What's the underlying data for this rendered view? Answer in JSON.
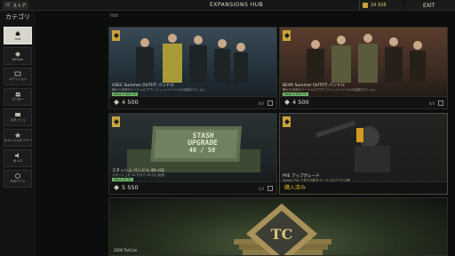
{
  "topbar": {
    "store_tab": "ストア",
    "hub_title": "EXPANSIONS HUB",
    "balance": "24 938",
    "exit_label": "EXIT"
  },
  "sidebar": {
    "heading": "カテゴリ",
    "items": [
      {
        "label": "Hot",
        "icon": "flame-icon",
        "active": true
      },
      {
        "label": "TarCoin",
        "icon": "coin-icon",
        "active": false
      },
      {
        "label": "エディション",
        "icon": "box-icon",
        "active": false
      },
      {
        "label": "アバター",
        "icon": "people-icon",
        "active": false
      },
      {
        "label": "スタッシュ",
        "icon": "crate-icon",
        "active": false
      },
      {
        "label": "スペシャルオファー",
        "icon": "star-icon",
        "active": false
      },
      {
        "label": "ボイス",
        "icon": "speaker-icon",
        "active": false
      },
      {
        "label": "PvEゾーン",
        "icon": "zone-icon",
        "active": false
      }
    ]
  },
  "filter_label": "Hot",
  "cards": [
    {
      "name": "USEC Summer OUTFIT バンドル",
      "desc": "極から未来のソーシャルアウトフィットバンドルの全部セクション",
      "tag": "Save 1 000 TC",
      "price": "4 500",
      "count": "0/4"
    },
    {
      "name": "BEAR Summer OUTFIT バンドル",
      "desc": "極から未来のソーシャルアウトフィットバンドルの全部セクション",
      "tag": "Save 1 000 TC",
      "price": "4 500",
      "count": "0/4"
    },
    {
      "name": "スタッシュ バンドル 40→50",
      "desc": "スタッシュを 40 行から 50 行に拡張",
      "tag": "Save 20 TC",
      "price": "5 550",
      "count": "1/3",
      "crate_text_top": "STASH",
      "crate_text_mid": "UPGRADE",
      "crate_text_bot": "40 / 50"
    },
    {
      "name": "PVE アップグレード",
      "desc": "Tarkov PvE で協力可能なモードへのアクセス権",
      "purchased": "購入済み"
    }
  ],
  "bottom_card": {
    "name": "2000 TarCoin"
  },
  "colors": {
    "accent_gold": "#c9a33d",
    "save_green": "#6fb56c",
    "purchased_gold": "#d8a92c"
  }
}
